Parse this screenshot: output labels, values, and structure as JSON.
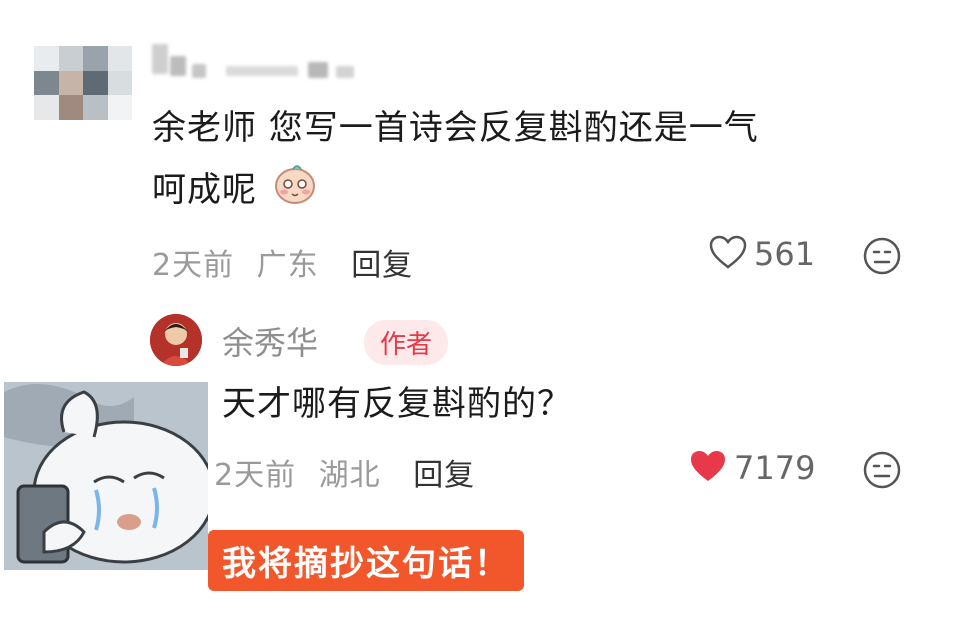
{
  "comment": {
    "text_line1": "余老师 您写一首诗会反复斟酌还是一气",
    "text_line2": "呵成呢",
    "time": "2天前",
    "location": "广东",
    "reply_label": "回复",
    "likes": "561"
  },
  "reply": {
    "author": "余秀华",
    "author_tag": "作者",
    "text": "天才哪有反复斟酌的？",
    "time": "2天前",
    "location": "湖北",
    "reply_label": "回复",
    "likes": "7179"
  },
  "sticker": {
    "caption": "我将摘抄这句话！"
  },
  "colors": {
    "tag_bg": "#fde8ea",
    "tag_text": "#e8394a",
    "liked_heart": "#e8394a",
    "caption_bg": "#f2562b"
  }
}
